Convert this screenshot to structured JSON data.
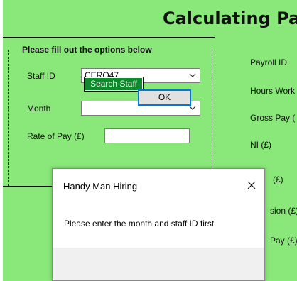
{
  "page_title": "Calculating Pa",
  "options_group": {
    "title": "Please fill out the options below",
    "staff_id_label": "Staff ID",
    "staff_id_value": "CERO47",
    "search_button": "Search Staff",
    "month_label": "Month",
    "month_value": "",
    "rate_label": "Rate of Pay (£)",
    "rate_value": ""
  },
  "right_labels": {
    "payroll_id": "Payroll ID",
    "hours_worked": "Hours Work",
    "gross_pay": "Gross Pay (",
    "ni": "NI (£)",
    "tax": "(£)",
    "pension": "sion (£)",
    "net_pay": "Pay (£)"
  },
  "dialog": {
    "title": "Handy Man Hiring",
    "message": "Please enter the month and staff ID first",
    "ok_label": "OK"
  },
  "colors": {
    "app_background": "#8ae87a",
    "search_button_bg": "#0e8a2c",
    "ok_focus_border": "#0078d7"
  }
}
